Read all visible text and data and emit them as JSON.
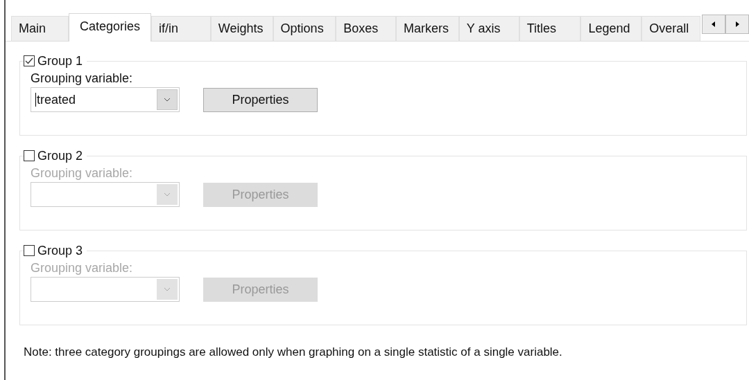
{
  "tabs": [
    {
      "label": "Main",
      "selected": false
    },
    {
      "label": "Categories",
      "selected": true
    },
    {
      "label": "if/in",
      "selected": false
    },
    {
      "label": "Weights",
      "selected": false
    },
    {
      "label": "Options",
      "selected": false
    },
    {
      "label": "Boxes",
      "selected": false
    },
    {
      "label": "Markers",
      "selected": false
    },
    {
      "label": "Y axis",
      "selected": false
    },
    {
      "label": "Titles",
      "selected": false
    },
    {
      "label": "Legend",
      "selected": false
    },
    {
      "label": "Overall",
      "selected": false
    }
  ],
  "groups": [
    {
      "label": "Group 1",
      "checked": true,
      "field_label": "Grouping variable:",
      "value": "treated",
      "button": "Properties"
    },
    {
      "label": "Group 2",
      "checked": false,
      "field_label": "Grouping variable:",
      "button": "Properties"
    },
    {
      "label": "Group 3",
      "checked": false,
      "field_label": "Grouping variable:",
      "button": "Properties"
    }
  ],
  "note": "Note: three category groupings are allowed only when graphing on a single statistic of a single variable."
}
